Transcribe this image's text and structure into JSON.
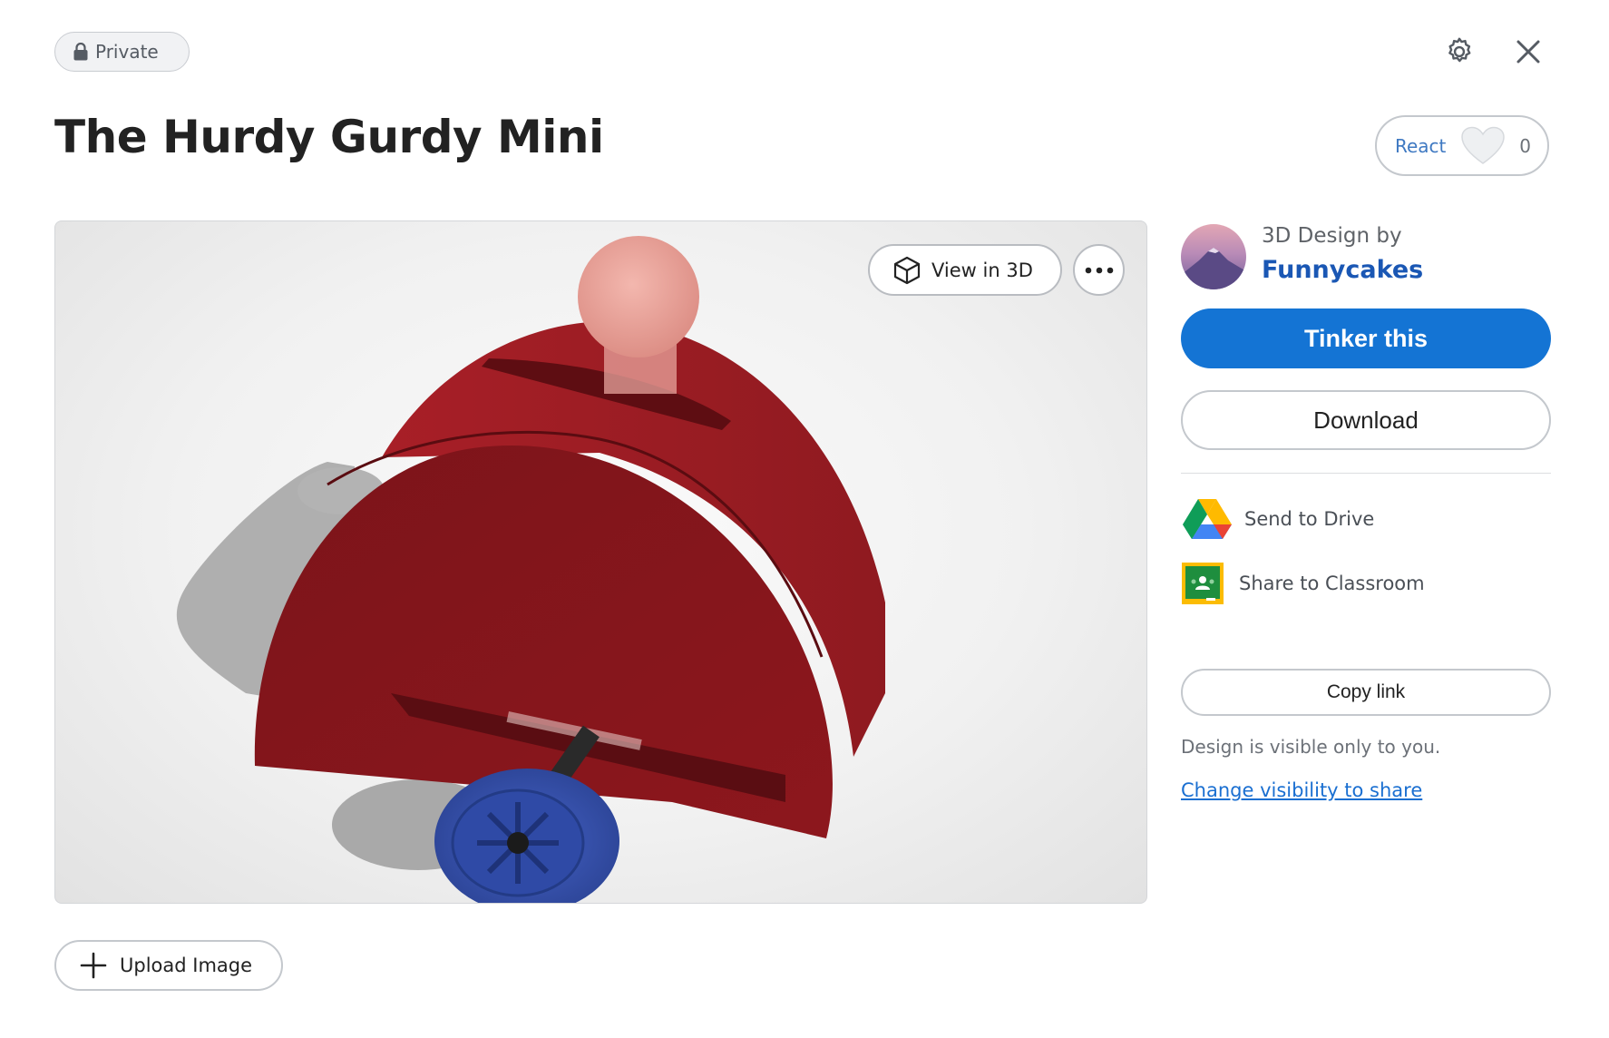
{
  "badge": {
    "label": "Private",
    "icon": "lock-icon"
  },
  "header": {
    "settings_icon": "gear-icon",
    "close_icon": "close-icon"
  },
  "design": {
    "title": "The Hurdy Gurdy Mini"
  },
  "react": {
    "label": "React",
    "count": "0",
    "icon": "heart-icon"
  },
  "preview": {
    "view3d_label": "View in 3D",
    "view3d_icon": "cube-icon",
    "more_icon": "more-horizontal-icon"
  },
  "author": {
    "byline": "3D Design by",
    "name": "Funnycakes"
  },
  "actions": {
    "tinker_label": "Tinker this",
    "download_label": "Download"
  },
  "share": {
    "drive_label": "Send to Drive",
    "classroom_label": "Share to Classroom",
    "copy_link_label": "Copy link",
    "visibility_note": "Design is visible only to you.",
    "change_visibility_label": "Change visibility to share"
  },
  "upload": {
    "label": "Upload Image",
    "icon": "plus-icon"
  },
  "colors": {
    "primary": "#1474d4",
    "link": "#1a6fd1",
    "author": "#1a57b4",
    "model_red": "#9b1b22",
    "wheel_blue": "#3a55b8"
  }
}
